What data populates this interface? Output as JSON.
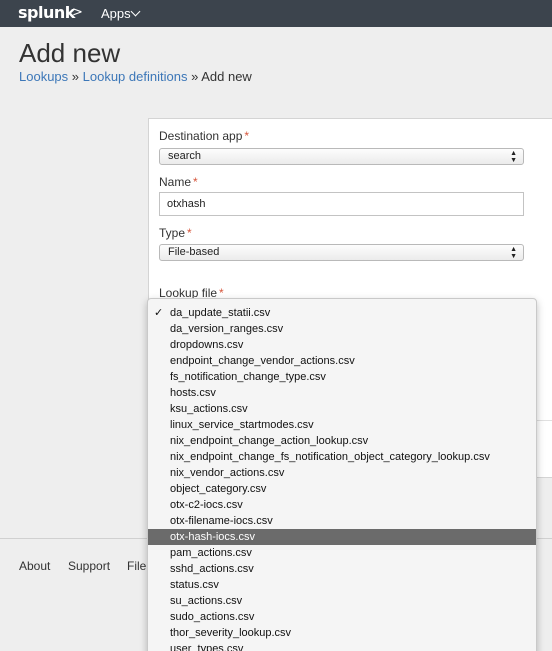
{
  "nav": {
    "logo": "splunk",
    "logo_mark": ">",
    "apps_label": "Apps"
  },
  "header": {
    "title": "Add new",
    "breadcrumb": [
      "Lookups",
      "Lookup definitions",
      "Add new"
    ],
    "separator": "»"
  },
  "form": {
    "destination_app": {
      "label": "Destination app",
      "required": "*",
      "value": "search"
    },
    "name": {
      "label": "Name",
      "required": "*",
      "value": "otxhash"
    },
    "type": {
      "label": "Type",
      "required": "*",
      "value": "File-based"
    },
    "lookup_file": {
      "label": "Lookup file",
      "required": "*"
    }
  },
  "dropdown": {
    "checkmark": "✓",
    "checked_index": 0,
    "highlighted_index": 14,
    "options": [
      "da_update_statii.csv",
      "da_version_ranges.csv",
      "dropdowns.csv",
      "endpoint_change_vendor_actions.csv",
      "fs_notification_change_type.csv",
      "hosts.csv",
      "ksu_actions.csv",
      "linux_service_startmodes.csv",
      "nix_endpoint_change_action_lookup.csv",
      "nix_endpoint_change_fs_notification_object_category_lookup.csv",
      "nix_vendor_actions.csv",
      "object_category.csv",
      "otx-c2-iocs.csv",
      "otx-filename-iocs.csv",
      "otx-hash-iocs.csv",
      "pam_actions.csv",
      "sshd_actions.csv",
      "status.csv",
      "su_actions.csv",
      "sudo_actions.csv",
      "thor_severity_lookup.csv",
      "user_types.csv"
    ]
  },
  "footer": {
    "links": [
      "About",
      "Support",
      "File"
    ]
  },
  "colors": {
    "nav_bg": "#3c444d",
    "link": "#3c77b8",
    "required": "#d6563c",
    "highlight": "#6b6b6b"
  }
}
